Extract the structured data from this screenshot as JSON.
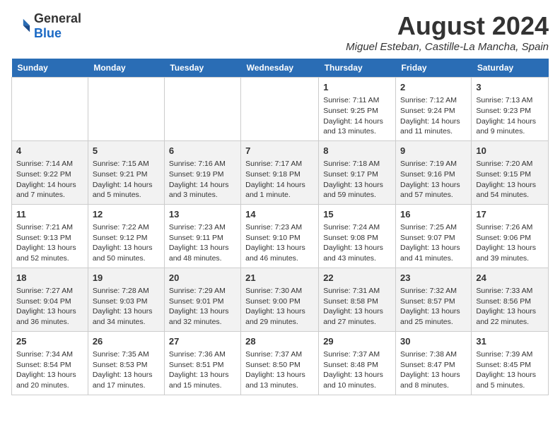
{
  "header": {
    "logo_general": "General",
    "logo_blue": "Blue",
    "month_year": "August 2024",
    "location": "Miguel Esteban, Castille-La Mancha, Spain"
  },
  "columns": [
    "Sunday",
    "Monday",
    "Tuesday",
    "Wednesday",
    "Thursday",
    "Friday",
    "Saturday"
  ],
  "weeks": [
    [
      {
        "day": "",
        "content": ""
      },
      {
        "day": "",
        "content": ""
      },
      {
        "day": "",
        "content": ""
      },
      {
        "day": "",
        "content": ""
      },
      {
        "day": "1",
        "content": "Sunrise: 7:11 AM\nSunset: 9:25 PM\nDaylight: 14 hours and 13 minutes."
      },
      {
        "day": "2",
        "content": "Sunrise: 7:12 AM\nSunset: 9:24 PM\nDaylight: 14 hours and 11 minutes."
      },
      {
        "day": "3",
        "content": "Sunrise: 7:13 AM\nSunset: 9:23 PM\nDaylight: 14 hours and 9 minutes."
      }
    ],
    [
      {
        "day": "4",
        "content": "Sunrise: 7:14 AM\nSunset: 9:22 PM\nDaylight: 14 hours and 7 minutes."
      },
      {
        "day": "5",
        "content": "Sunrise: 7:15 AM\nSunset: 9:21 PM\nDaylight: 14 hours and 5 minutes."
      },
      {
        "day": "6",
        "content": "Sunrise: 7:16 AM\nSunset: 9:19 PM\nDaylight: 14 hours and 3 minutes."
      },
      {
        "day": "7",
        "content": "Sunrise: 7:17 AM\nSunset: 9:18 PM\nDaylight: 14 hours and 1 minute."
      },
      {
        "day": "8",
        "content": "Sunrise: 7:18 AM\nSunset: 9:17 PM\nDaylight: 13 hours and 59 minutes."
      },
      {
        "day": "9",
        "content": "Sunrise: 7:19 AM\nSunset: 9:16 PM\nDaylight: 13 hours and 57 minutes."
      },
      {
        "day": "10",
        "content": "Sunrise: 7:20 AM\nSunset: 9:15 PM\nDaylight: 13 hours and 54 minutes."
      }
    ],
    [
      {
        "day": "11",
        "content": "Sunrise: 7:21 AM\nSunset: 9:13 PM\nDaylight: 13 hours and 52 minutes."
      },
      {
        "day": "12",
        "content": "Sunrise: 7:22 AM\nSunset: 9:12 PM\nDaylight: 13 hours and 50 minutes."
      },
      {
        "day": "13",
        "content": "Sunrise: 7:23 AM\nSunset: 9:11 PM\nDaylight: 13 hours and 48 minutes."
      },
      {
        "day": "14",
        "content": "Sunrise: 7:23 AM\nSunset: 9:10 PM\nDaylight: 13 hours and 46 minutes."
      },
      {
        "day": "15",
        "content": "Sunrise: 7:24 AM\nSunset: 9:08 PM\nDaylight: 13 hours and 43 minutes."
      },
      {
        "day": "16",
        "content": "Sunrise: 7:25 AM\nSunset: 9:07 PM\nDaylight: 13 hours and 41 minutes."
      },
      {
        "day": "17",
        "content": "Sunrise: 7:26 AM\nSunset: 9:06 PM\nDaylight: 13 hours and 39 minutes."
      }
    ],
    [
      {
        "day": "18",
        "content": "Sunrise: 7:27 AM\nSunset: 9:04 PM\nDaylight: 13 hours and 36 minutes."
      },
      {
        "day": "19",
        "content": "Sunrise: 7:28 AM\nSunset: 9:03 PM\nDaylight: 13 hours and 34 minutes."
      },
      {
        "day": "20",
        "content": "Sunrise: 7:29 AM\nSunset: 9:01 PM\nDaylight: 13 hours and 32 minutes."
      },
      {
        "day": "21",
        "content": "Sunrise: 7:30 AM\nSunset: 9:00 PM\nDaylight: 13 hours and 29 minutes."
      },
      {
        "day": "22",
        "content": "Sunrise: 7:31 AM\nSunset: 8:58 PM\nDaylight: 13 hours and 27 minutes."
      },
      {
        "day": "23",
        "content": "Sunrise: 7:32 AM\nSunset: 8:57 PM\nDaylight: 13 hours and 25 minutes."
      },
      {
        "day": "24",
        "content": "Sunrise: 7:33 AM\nSunset: 8:56 PM\nDaylight: 13 hours and 22 minutes."
      }
    ],
    [
      {
        "day": "25",
        "content": "Sunrise: 7:34 AM\nSunset: 8:54 PM\nDaylight: 13 hours and 20 minutes."
      },
      {
        "day": "26",
        "content": "Sunrise: 7:35 AM\nSunset: 8:53 PM\nDaylight: 13 hours and 17 minutes."
      },
      {
        "day": "27",
        "content": "Sunrise: 7:36 AM\nSunset: 8:51 PM\nDaylight: 13 hours and 15 minutes."
      },
      {
        "day": "28",
        "content": "Sunrise: 7:37 AM\nSunset: 8:50 PM\nDaylight: 13 hours and 13 minutes."
      },
      {
        "day": "29",
        "content": "Sunrise: 7:37 AM\nSunset: 8:48 PM\nDaylight: 13 hours and 10 minutes."
      },
      {
        "day": "30",
        "content": "Sunrise: 7:38 AM\nSunset: 8:47 PM\nDaylight: 13 hours and 8 minutes."
      },
      {
        "day": "31",
        "content": "Sunrise: 7:39 AM\nSunset: 8:45 PM\nDaylight: 13 hours and 5 minutes."
      }
    ]
  ]
}
